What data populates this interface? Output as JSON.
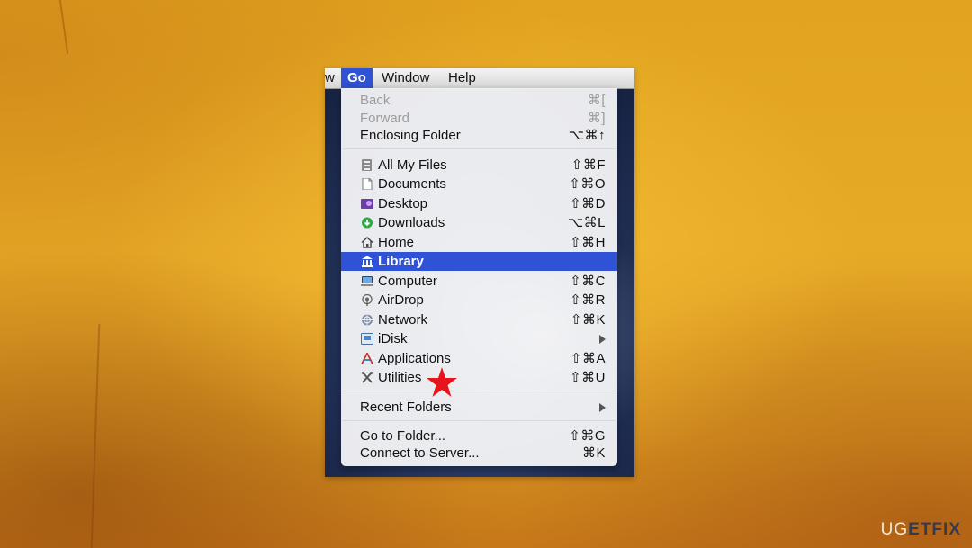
{
  "menubar": {
    "partial_item": "w",
    "items": [
      "Go",
      "Window",
      "Help"
    ],
    "active": "Go"
  },
  "go_menu": {
    "groups": [
      [
        {
          "label": "Back",
          "shortcut": "⌘[",
          "disabled": true
        },
        {
          "label": "Forward",
          "shortcut": "⌘]",
          "disabled": true
        },
        {
          "label": "Enclosing Folder",
          "shortcut": "⌥⌘↑"
        }
      ],
      [
        {
          "label": "All My Files",
          "shortcut": "⇧⌘F",
          "icon": "all-my-files-icon"
        },
        {
          "label": "Documents",
          "shortcut": "⇧⌘O",
          "icon": "documents-icon"
        },
        {
          "label": "Desktop",
          "shortcut": "⇧⌘D",
          "icon": "desktop-icon"
        },
        {
          "label": "Downloads",
          "shortcut": "⌥⌘L",
          "icon": "downloads-icon"
        },
        {
          "label": "Home",
          "shortcut": "⇧⌘H",
          "icon": "home-icon"
        },
        {
          "label": "Library",
          "shortcut": "",
          "icon": "library-icon",
          "selected": true
        },
        {
          "label": "Computer",
          "shortcut": "⇧⌘C",
          "icon": "computer-icon"
        },
        {
          "label": "AirDrop",
          "shortcut": "⇧⌘R",
          "icon": "airdrop-icon"
        },
        {
          "label": "Network",
          "shortcut": "⇧⌘K",
          "icon": "network-icon"
        },
        {
          "label": "iDisk",
          "shortcut": "",
          "icon": "idisk-icon",
          "submenu": true
        },
        {
          "label": "Applications",
          "shortcut": "⇧⌘A",
          "icon": "applications-icon"
        },
        {
          "label": "Utilities",
          "shortcut": "⇧⌘U",
          "icon": "utilities-icon"
        }
      ],
      [
        {
          "label": "Recent Folders",
          "shortcut": "",
          "submenu": true
        }
      ],
      [
        {
          "label": "Go to Folder...",
          "shortcut": "⇧⌘G"
        },
        {
          "label": "Connect to Server...",
          "shortcut": "⌘K"
        }
      ]
    ]
  },
  "annotation": {
    "marker": "red-star",
    "color": "#e8141c"
  },
  "watermark": {
    "part1": "UG",
    "part2": "ETFIX"
  },
  "colors": {
    "selection": "#2f52d6",
    "background": "#e2a41f"
  }
}
